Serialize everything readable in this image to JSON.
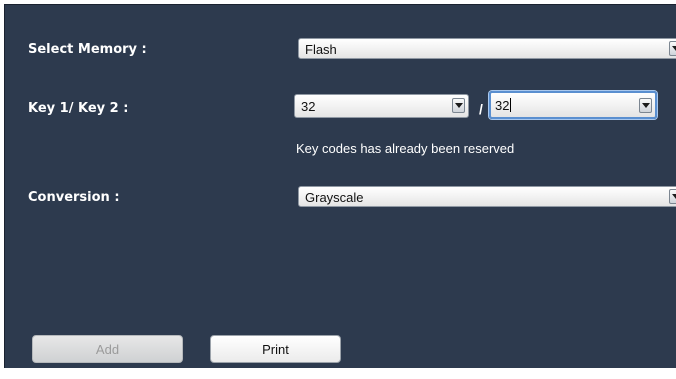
{
  "form": {
    "memory": {
      "label": "Select Memory :",
      "value": "Flash"
    },
    "keys": {
      "label": "Key 1/ Key 2 :",
      "key1_value": "32",
      "separator": "/",
      "key2_value": "32",
      "message": "Key codes has already been reserved"
    },
    "conversion": {
      "label": "Conversion :",
      "value": "Grayscale"
    }
  },
  "buttons": {
    "add": {
      "label": "Add",
      "enabled": false
    },
    "print": {
      "label": "Print",
      "enabled": true
    }
  },
  "colors": {
    "panel_background": "#2d3a4e",
    "label_text": "#ffffff",
    "focus_border": "#5a8fd0"
  }
}
